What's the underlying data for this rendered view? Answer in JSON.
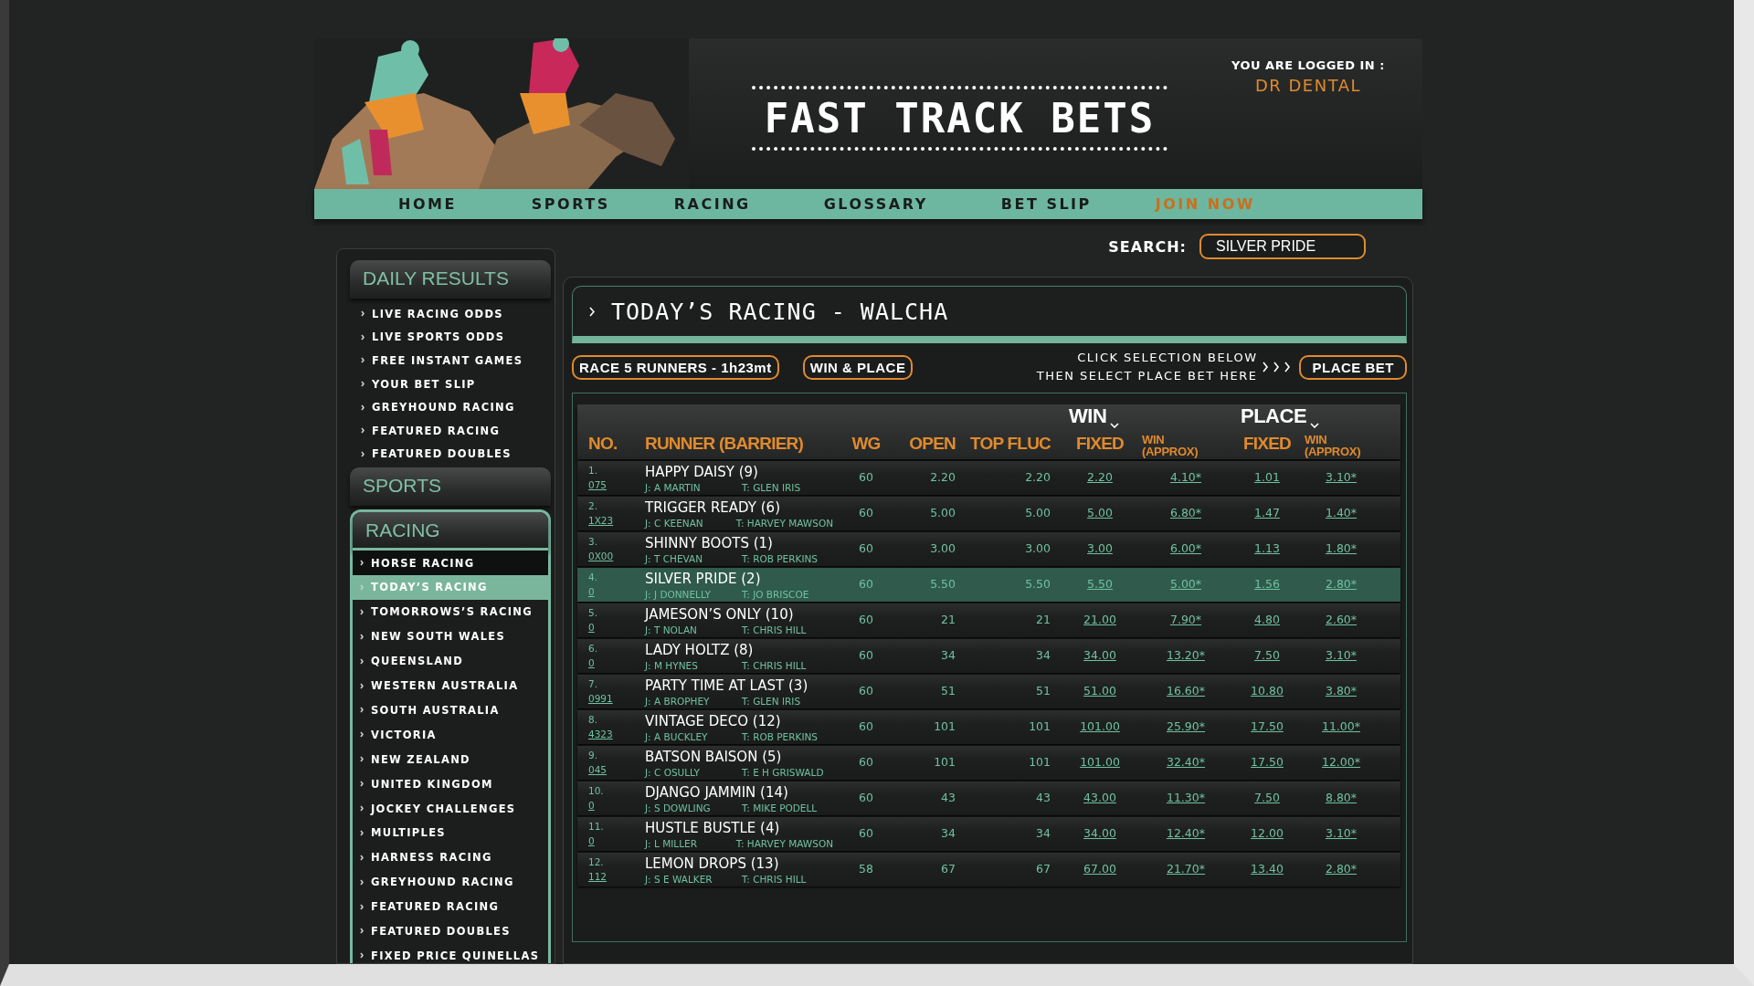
{
  "header": {
    "title": "FAST TRACK BETS",
    "login_label": "YOU ARE LOGGED IN :",
    "user": "DR DENTAL"
  },
  "nav": [
    {
      "label": "HOME",
      "kind": "link"
    },
    {
      "label": "SPORTS",
      "kind": "link"
    },
    {
      "label": "RACING",
      "kind": "link"
    },
    {
      "label": "GLOSSARY",
      "kind": "link"
    },
    {
      "label": "BET SLIP",
      "kind": "link"
    },
    {
      "label": "JOIN NOW",
      "kind": "cta"
    }
  ],
  "search": {
    "label": "SEARCH:",
    "value": "SILVER PRIDE"
  },
  "sidebar": [
    {
      "title": "DAILY RESULTS",
      "active": false,
      "items": [
        {
          "label": "LIVE RACING ODDS",
          "selected": false
        },
        {
          "label": "LIVE SPORTS ODDS",
          "selected": false
        },
        {
          "label": "FREE INSTANT GAMES",
          "selected": false
        },
        {
          "label": "YOUR BET SLIP",
          "selected": false
        },
        {
          "label": "GREYHOUND RACING",
          "selected": false
        },
        {
          "label": "FEATURED RACING",
          "selected": false
        },
        {
          "label": "FEATURED DOUBLES",
          "selected": false
        }
      ]
    },
    {
      "title": "SPORTS",
      "active": false
    },
    {
      "title": "RACING",
      "active": true,
      "items": [
        {
          "label": "HORSE RACING",
          "selected": false,
          "children": [
            {
              "label": "TODAY’S RACING",
              "selected": true
            },
            {
              "label": "TOMORROWS’S RACING",
              "selected": false
            },
            {
              "label": "NEW SOUTH WALES",
              "selected": false
            },
            {
              "label": "QUEENSLAND",
              "selected": false
            },
            {
              "label": "WESTERN AUSTRALIA",
              "selected": false
            },
            {
              "label": "SOUTH AUSTRALIA",
              "selected": false
            },
            {
              "label": "VICTORIA",
              "selected": false
            },
            {
              "label": "NEW ZEALAND",
              "selected": false
            },
            {
              "label": "UNITED KINGDOM",
              "selected": false
            }
          ]
        },
        {
          "label": "JOCKEY CHALLENGES",
          "selected": false
        },
        {
          "label": "MULTIPLES",
          "selected": false
        },
        {
          "label": "HARNESS RACING",
          "selected": false
        },
        {
          "label": "GREYHOUND RACING",
          "selected": false
        },
        {
          "label": "FEATURED RACING",
          "selected": false
        },
        {
          "label": "FEATURED DOUBLES",
          "selected": false
        },
        {
          "label": "FIXED PRICE QUINELLAS",
          "selected": false
        }
      ]
    }
  ],
  "race": {
    "title": "TODAY’S RACING - WALCHA",
    "race_info": "RACE 5 RUNNERS - 1h23mt",
    "bet_type": "WIN & PLACE",
    "instruction": [
      "CLICK SELECTION BELOW",
      "THEN SELECT PLACE BET HERE"
    ],
    "place_bet": "PLACE BET",
    "groups": [
      {
        "label": "WIN"
      },
      {
        "label": "PLACE"
      }
    ],
    "columns": [
      "NO.",
      "RUNNER  (BARRIER)",
      "WG",
      "OPEN",
      "TOP FLUC",
      "FIXED",
      "WIN (APPROX)",
      "FIXED",
      "WIN (APPROX)"
    ],
    "rows": [
      {
        "no": "1.",
        "form": "075",
        "runner": "HAPPY DAISY (9)",
        "jockey": "J: A MARTIN",
        "trainer": "T: GLEN IRIS",
        "wg": "60",
        "open": "2.20",
        "top_fluc": "2.20",
        "win_fixed": "2.20",
        "win_approx": "4.10*",
        "place_fixed": "1.01",
        "place_approx": "3.10*",
        "selected": false
      },
      {
        "no": "2.",
        "form": "1X23",
        "runner": "TRIGGER READY (6)",
        "jockey": "J: C KEENAN",
        "trainer": "T: HARVEY MAWSON",
        "wg": "60",
        "open": "5.00",
        "top_fluc": "5.00",
        "win_fixed": "5.00",
        "win_approx": "6.80*",
        "place_fixed": "1.47",
        "place_approx": "1.40*",
        "selected": false
      },
      {
        "no": "3.",
        "form": "0X00",
        "runner": "SHINNY BOOTS (1)",
        "jockey": "J: T CHEVAN",
        "trainer": "T: ROB PERKINS",
        "wg": "60",
        "open": "3.00",
        "top_fluc": "3.00",
        "win_fixed": "3.00",
        "win_approx": "6.00*",
        "place_fixed": "1.13",
        "place_approx": "1.80*",
        "selected": false
      },
      {
        "no": "4.",
        "form": "0",
        "runner": "SILVER PRIDE (2)",
        "jockey": "J: J DONNELLY",
        "trainer": "T: JO BRISCOE",
        "wg": "60",
        "open": "5.50",
        "top_fluc": "5.50",
        "win_fixed": "5.50",
        "win_approx": "5.00*",
        "place_fixed": "1.56",
        "place_approx": "2.80*",
        "selected": true
      },
      {
        "no": "5.",
        "form": "0",
        "runner": "JAMESON’S ONLY (10)",
        "jockey": "J: T NOLAN",
        "trainer": "T: CHRIS HILL",
        "wg": "60",
        "open": "21",
        "top_fluc": "21",
        "win_fixed": "21.00",
        "win_approx": "7.90*",
        "place_fixed": "4.80",
        "place_approx": "2.60*",
        "selected": false
      },
      {
        "no": "6.",
        "form": "0",
        "runner": "LADY HOLTZ (8)",
        "jockey": "J: M HYNES",
        "trainer": "T: CHRIS HILL",
        "wg": "60",
        "open": "34",
        "top_fluc": "34",
        "win_fixed": "34.00",
        "win_approx": "13.20*",
        "place_fixed": "7.50",
        "place_approx": "3.10*",
        "selected": false
      },
      {
        "no": "7.",
        "form": "0991",
        "runner": "PARTY TIME AT LAST (3)",
        "jockey": "J: A BROPHEY",
        "trainer": "T: GLEN IRIS",
        "wg": "60",
        "open": "51",
        "top_fluc": "51",
        "win_fixed": "51.00",
        "win_approx": "16.60*",
        "place_fixed": "10.80",
        "place_approx": "3.80*",
        "selected": false
      },
      {
        "no": "8.",
        "form": "4323",
        "runner": "VINTAGE DECO (12)",
        "jockey": "J: A BUCKLEY",
        "trainer": "T: ROB PERKINS",
        "wg": "60",
        "open": "101",
        "top_fluc": "101",
        "win_fixed": "101.00",
        "win_approx": "25.90*",
        "place_fixed": "17.50",
        "place_approx": "11.00*",
        "selected": false
      },
      {
        "no": "9.",
        "form": "045",
        "runner": "BATSON BAISON (5)",
        "jockey": "J: C OSULLY",
        "trainer": "T: E H GRISWALD",
        "wg": "60",
        "open": "101",
        "top_fluc": "101",
        "win_fixed": "101.00",
        "win_approx": "32.40*",
        "place_fixed": "17.50",
        "place_approx": "12.00*",
        "selected": false
      },
      {
        "no": "10.",
        "form": "0",
        "runner": "DJANGO JAMMIN (14)",
        "jockey": "J: S DOWLING",
        "trainer": "T: MIKE PODELL",
        "wg": "60",
        "open": "43",
        "top_fluc": "43",
        "win_fixed": "43.00",
        "win_approx": "11.30*",
        "place_fixed": "7.50",
        "place_approx": "8.80*",
        "selected": false
      },
      {
        "no": "11.",
        "form": "0",
        "runner": "HUSTLE BUSTLE (4)",
        "jockey": "J: L MILLER",
        "trainer": "T: HARVEY MAWSON",
        "wg": "60",
        "open": "34",
        "top_fluc": "34",
        "win_fixed": "34.00",
        "win_approx": "12.40*",
        "place_fixed": "12.00",
        "place_approx": "3.10*",
        "selected": false
      },
      {
        "no": "12.",
        "form": "112",
        "runner": "LEMON DROPS (13)",
        "jockey": "J: S E WALKER",
        "trainer": "T: CHRIS HILL",
        "wg": "58",
        "open": "67",
        "top_fluc": "67",
        "win_fixed": "67.00",
        "win_approx": "21.70*",
        "place_fixed": "13.40",
        "place_approx": "2.80*",
        "selected": false
      }
    ]
  }
}
